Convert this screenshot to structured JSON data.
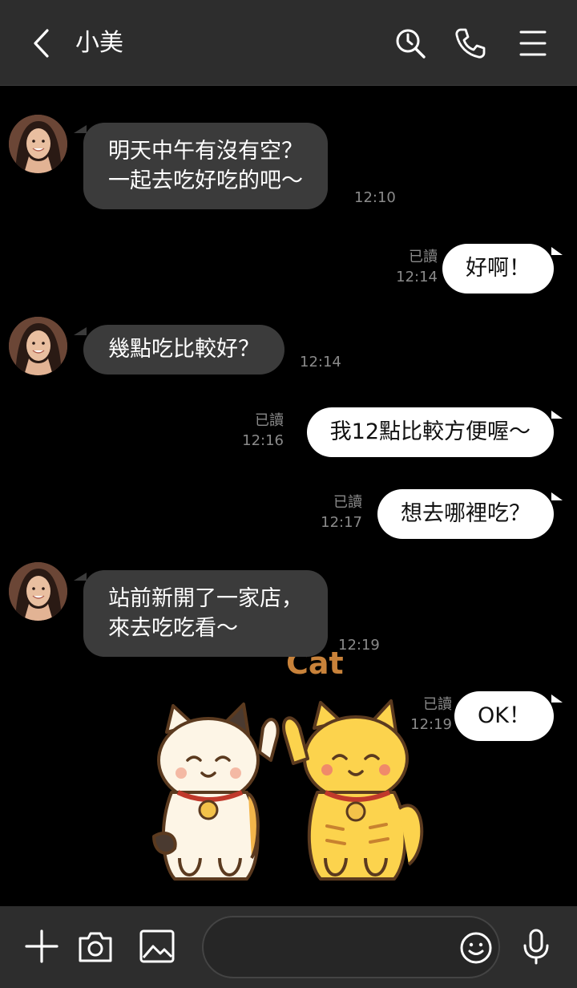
{
  "header": {
    "title": "小美"
  },
  "messages": [
    {
      "side": "in",
      "lines": [
        "明天中午有沒有空？",
        "一起去吃好吃的吧～"
      ],
      "time": "12:10"
    },
    {
      "side": "out",
      "text": "好啊！",
      "read": "已讀",
      "time": "12:14"
    },
    {
      "side": "in",
      "lines": [
        "幾點吃比較好？"
      ],
      "time": "12:14"
    },
    {
      "side": "out",
      "text": "我12點比較方便喔～",
      "read": "已讀",
      "time": "12:16"
    },
    {
      "side": "out",
      "text": "想去哪裡吃？",
      "read": "已讀",
      "time": "12:17"
    },
    {
      "side": "in",
      "lines": [
        "站前新開了一家店，",
        "來去吃吃看～"
      ],
      "time": "12:19"
    },
    {
      "side": "out",
      "text": "OK！",
      "read": "已讀",
      "time": "12:19"
    }
  ],
  "sticker": {
    "caption": "Cat"
  },
  "colors": {
    "header_bg": "#2d2d2d",
    "chat_bg": "#000000",
    "incoming_bubble": "#3b3b3b",
    "outgoing_bubble": "#ffffff",
    "meta_text": "#8a8a8a"
  },
  "icons": {
    "back": "chevron-left-icon",
    "search": "search-history-icon",
    "call": "phone-icon",
    "menu": "hamburger-menu-icon",
    "plus": "plus-icon",
    "camera": "camera-icon",
    "image": "image-icon",
    "emoji": "smiley-icon",
    "mic": "microphone-icon"
  }
}
